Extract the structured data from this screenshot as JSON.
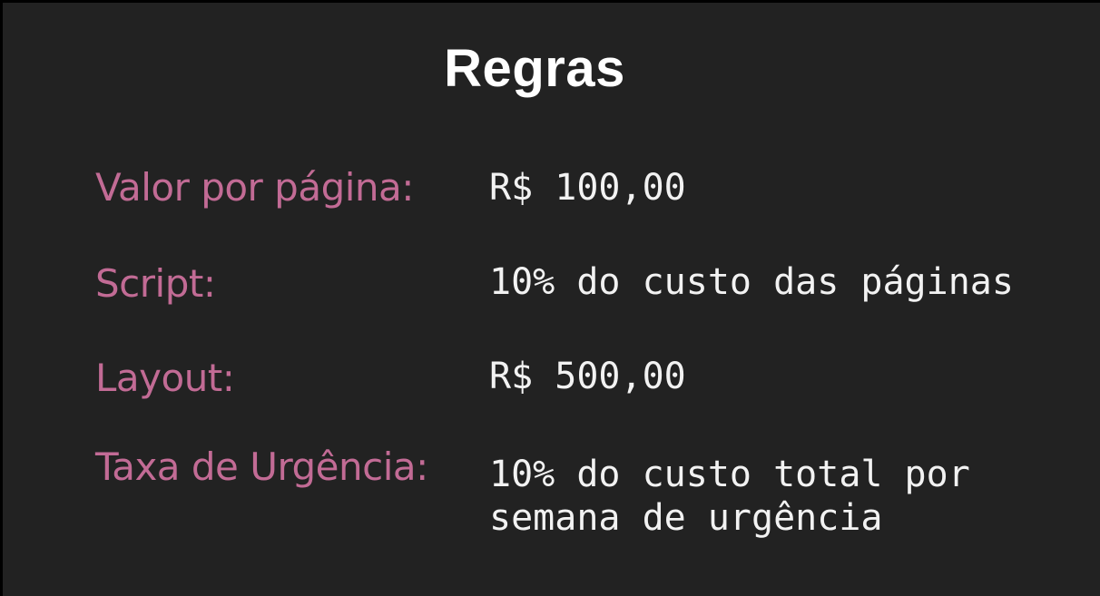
{
  "title": "Regras",
  "rules": [
    {
      "label": "Valor por página:",
      "value": "R$ 100,00"
    },
    {
      "label": "Script:",
      "value": "10% do custo das páginas"
    },
    {
      "label": "Layout:",
      "value": "R$ 500,00"
    },
    {
      "label": "Taxa de Urgência:",
      "value_line1": "10% do custo total por",
      "value_line2": "semana de urgência"
    }
  ]
}
